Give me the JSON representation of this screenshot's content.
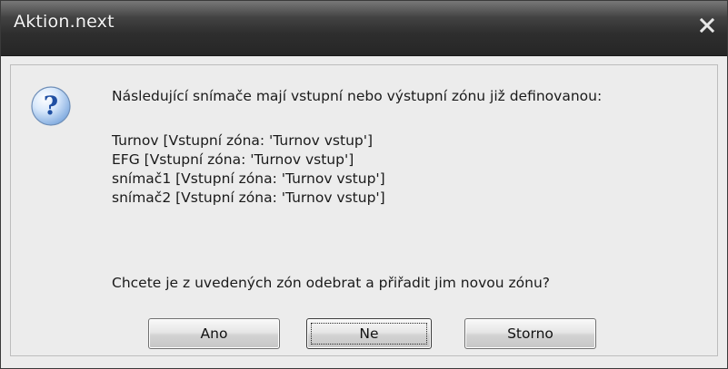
{
  "window": {
    "title": "Aktion.next",
    "close_icon": "close-icon"
  },
  "dialog": {
    "icon": "question-icon",
    "message": "Následující snímače mají vstupní nebo výstupní zónu již definovanou:",
    "items": [
      "Turnov [Vstupní zóna: 'Turnov vstup']",
      "EFG [Vstupní zóna: 'Turnov vstup']",
      "snímač1 [Vstupní zóna: 'Turnov vstup']",
      "snímač2 [Vstupní zóna: 'Turnov vstup']"
    ],
    "question": "Chcete je z uvedených zón odebrat a přiřadit jim novou zónu?"
  },
  "buttons": {
    "yes_label": "Ano",
    "no_label": "Ne",
    "cancel_label": "Storno",
    "focused": "Ne"
  },
  "colors": {
    "titlebar": "#2e2e2e",
    "title_text": "#f4f4f4",
    "client_bg": "#ececec",
    "icon_blue": "#2a6fd1"
  }
}
